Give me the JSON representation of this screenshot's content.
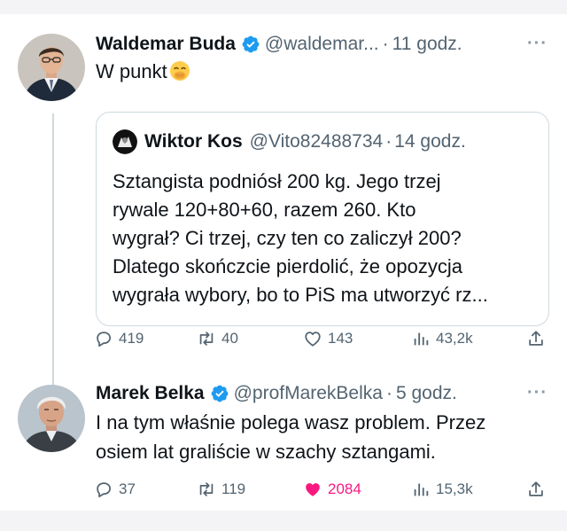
{
  "tweets": [
    {
      "name": "Waldemar Buda",
      "handle": "@waldemar...",
      "dot": "·",
      "time": "11 godz.",
      "text": "W punkt",
      "emoji": "hand-over-mouth-emoji",
      "quote": {
        "name": "Wiktor Kos",
        "handle": "@Vito82488734",
        "dot": "·",
        "time": "14 godz.",
        "lines": [
          "Sztangista podniósł 200 kg. Jego trzej",
          "rywale 120+80+60, razem 260. Kto",
          "wygrał? Ci trzej, czy ten co zaliczył 200?",
          "Dlatego skończcie pierdolić, że opozycja",
          "wygrała wybory, bo to PiS ma utworzyć rz..."
        ]
      },
      "actions": {
        "replies": "419",
        "reposts": "40",
        "likes": "143",
        "views": "43,2k"
      }
    },
    {
      "name": "Marek Belka",
      "handle": "@profMarekBelka",
      "dot": "·",
      "time": "5 godz.",
      "lines": [
        "I na tym właśnie polega wasz problem. Przez",
        "osiem lat graliście w szachy sztangami."
      ],
      "actions": {
        "replies": "37",
        "reposts": "119",
        "likes": "2084",
        "views": "15,3k",
        "liked": true
      }
    }
  ],
  "more_label": "···",
  "icons": {
    "verified": "verified-badge-icon",
    "reply": "reply-icon",
    "repost": "repost-icon",
    "like": "heart-icon",
    "views": "views-icon",
    "share": "share-icon"
  },
  "colors": {
    "verified": "#1d9bf0",
    "like_active": "#f91880",
    "muted": "#536471",
    "border": "#cfd9de"
  }
}
